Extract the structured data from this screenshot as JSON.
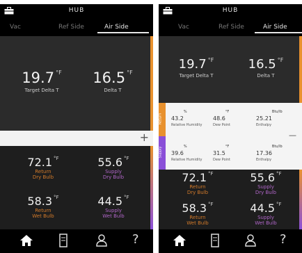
{
  "app": {
    "title": "HUB"
  },
  "tabs": [
    {
      "label": "Vac"
    },
    {
      "label": "Ref Side"
    },
    {
      "label": "Air Side"
    }
  ],
  "left": {
    "target_delta_t": {
      "value": "19.7",
      "unit": "°F",
      "label": "Target Delta T"
    },
    "delta_t": {
      "value": "16.5",
      "unit": "°F",
      "label": "Delta T"
    },
    "return_dry_bulb": {
      "value": "72.1",
      "unit": "°F",
      "label1": "Return",
      "label2": "Dry Bulb"
    },
    "supply_dry_bulb": {
      "value": "55.6",
      "unit": "°F",
      "label1": "Supply",
      "label2": "Dry Bulb"
    },
    "return_wet_bulb": {
      "value": "58.3",
      "unit": "°F",
      "label1": "Return",
      "label2": "Wet Bulb"
    },
    "supply_wet_bulb": {
      "value": "44.5",
      "unit": "°F",
      "label1": "Supply",
      "label2": "Wet Bulb"
    },
    "plus_symbol": "+"
  },
  "right": {
    "target_delta_t": {
      "value": "19.7",
      "unit": "°F",
      "label": "Target Delta T"
    },
    "delta_t": {
      "value": "16.5",
      "unit": "°F",
      "label": "Delta T"
    },
    "return_row": {
      "side_label": "Return",
      "rh": {
        "value": "43.2",
        "unit": "%",
        "label": "Relative Humidity"
      },
      "dp": {
        "value": "48.6",
        "unit": "°F",
        "label": "Dew Point"
      },
      "enthalpy": {
        "value": "25.21",
        "unit": "Btu/lb",
        "label": "Enthalpy"
      }
    },
    "supply_row": {
      "side_label": "Supply",
      "rh": {
        "value": "39.6",
        "unit": "%",
        "label": "Relative Humidity"
      },
      "dp": {
        "value": "31.5",
        "unit": "°F",
        "label": "Dew Point"
      },
      "enthalpy": {
        "value": "17.36",
        "unit": "Btu/lb",
        "label": "Enthalpy"
      }
    },
    "minus_symbol": "—",
    "return_dry_bulb": {
      "value": "72.1",
      "unit": "°F",
      "label1": "Return",
      "label2": "Dry Bulb"
    },
    "supply_dry_bulb": {
      "value": "55.6",
      "unit": "°F",
      "label1": "Supply",
      "label2": "Dry Bulb"
    },
    "return_wet_bulb": {
      "value": "58.3",
      "unit": "°F",
      "label1": "Return",
      "label2": "Wet Bulb"
    },
    "supply_wet_bulb": {
      "value": "44.5",
      "unit": "°F",
      "label1": "Supply",
      "label2": "Wet Bulb"
    }
  },
  "nav_icons": [
    "home-icon",
    "meter-icon",
    "user-icon",
    "help-icon"
  ],
  "nav_help_glyph": "?",
  "colors": {
    "return": "#d27a2a",
    "supply": "#b066c8",
    "accent_orange": "#e8912e",
    "accent_purple": "#8a4fd8"
  }
}
